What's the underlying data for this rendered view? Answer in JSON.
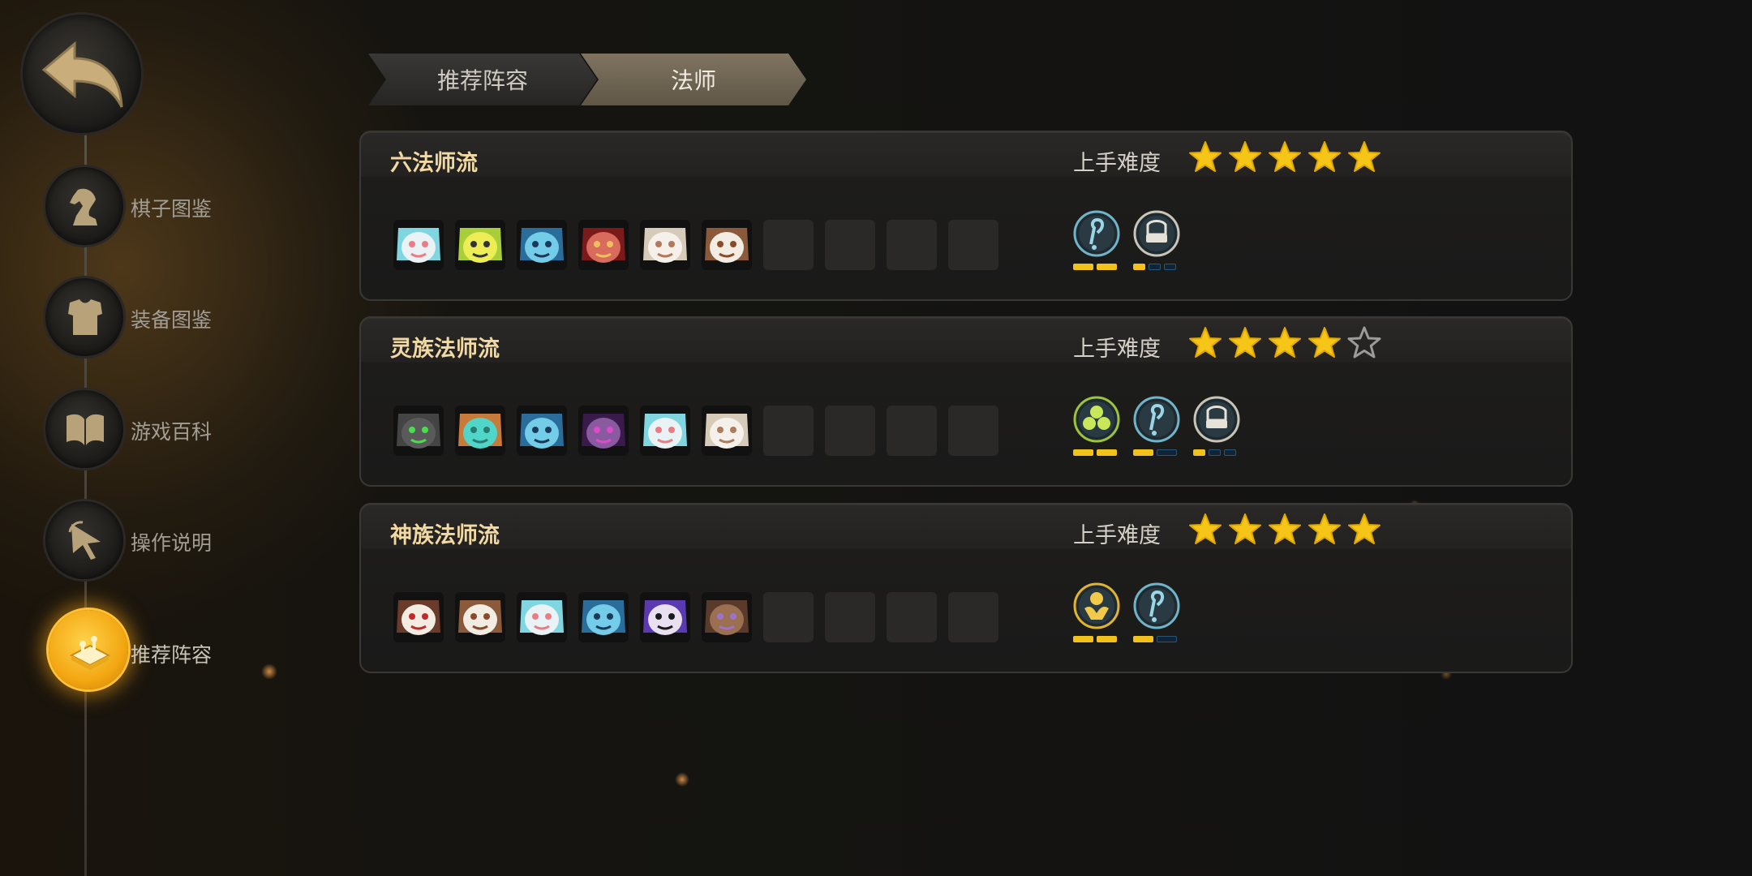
{
  "sidebar": {
    "back_label": "",
    "items": [
      {
        "label": "棋子图鉴",
        "icon": "knight-icon",
        "active": false
      },
      {
        "label": "装备图鉴",
        "icon": "armor-icon",
        "active": false
      },
      {
        "label": "游戏百科",
        "icon": "book-icon",
        "active": false
      },
      {
        "label": "操作说明",
        "icon": "cursor-icon",
        "active": false
      },
      {
        "label": "推荐阵容",
        "icon": "chessboard-icon",
        "active": true
      }
    ]
  },
  "breadcrumb": {
    "items": [
      "推荐阵容",
      "法师"
    ]
  },
  "lineups": [
    {
      "title": "六法师流",
      "difficulty_label": "上手难度",
      "difficulty_stars": 5,
      "pieces": [
        "polar-bear",
        "green-bird",
        "crystal-mage",
        "red-ninja",
        "white-elder",
        "brown-elder"
      ],
      "empty_slots": 4,
      "synergies": [
        {
          "icon": "mage-icon",
          "ring": "#6fb4c8",
          "filled": 2,
          "total": 2
        },
        {
          "icon": "throne-icon",
          "ring": "#c9c4b8",
          "filled": 1,
          "total": 3
        }
      ]
    },
    {
      "title": "灵族法师流",
      "difficulty_label": "上手难度",
      "difficulty_stars": 4,
      "pieces": [
        "green-orb-golem",
        "teal-robot",
        "crystal-mage",
        "purple-demon",
        "polar-bear",
        "white-elder"
      ],
      "empty_slots": 4,
      "synergies": [
        {
          "icon": "spirit-icon",
          "ring": "#9cc43a",
          "filled": 2,
          "total": 2
        },
        {
          "icon": "mage-icon",
          "ring": "#6fb4c8",
          "filled": 1,
          "total": 2
        },
        {
          "icon": "throne-icon",
          "ring": "#c9c4b8",
          "filled": 1,
          "total": 3
        }
      ]
    },
    {
      "title": "神族法师流",
      "difficulty_label": "上手难度",
      "difficulty_stars": 5,
      "pieces": [
        "red-elder",
        "brown-elder",
        "polar-bear",
        "crystal-mage",
        "purple-wizard",
        "hooded-monk"
      ],
      "empty_slots": 4,
      "synergies": [
        {
          "icon": "god-icon",
          "ring": "#e0b431",
          "filled": 2,
          "total": 2
        },
        {
          "icon": "mage-icon",
          "ring": "#6fb4c8",
          "filled": 1,
          "total": 2
        }
      ]
    }
  ],
  "colors": {
    "accent_gold": "#f3c21a",
    "title_gold": "#f1d9a3",
    "star_empty": "#9b9b9b"
  }
}
